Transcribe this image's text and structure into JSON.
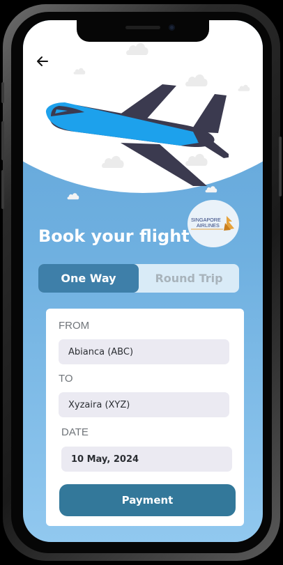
{
  "page": {
    "title": "Book your flight",
    "back_icon": "arrow-left-icon"
  },
  "brand": {
    "name_line1": "SINGAPORE",
    "name_line2": "AIRLINES",
    "logo_icon": "singapore-airlines-bird-icon"
  },
  "trip_type": {
    "options": [
      "One Way",
      "Round Trip"
    ],
    "selected": "One Way"
  },
  "form": {
    "from_label": "FROM",
    "from_value": "Abianca (ABC)",
    "to_label": "TO",
    "to_value": "Xyzaira (XYZ)",
    "date_label": "DATE",
    "date_value": "10 May, 2024"
  },
  "actions": {
    "payment_label": "Payment"
  },
  "colors": {
    "accent": "#3e7fa9",
    "button": "#33789a",
    "sky_top": "#5fa3d7",
    "plane_body": "#3b3a4f",
    "plane_stripe": "#1da1ec"
  }
}
